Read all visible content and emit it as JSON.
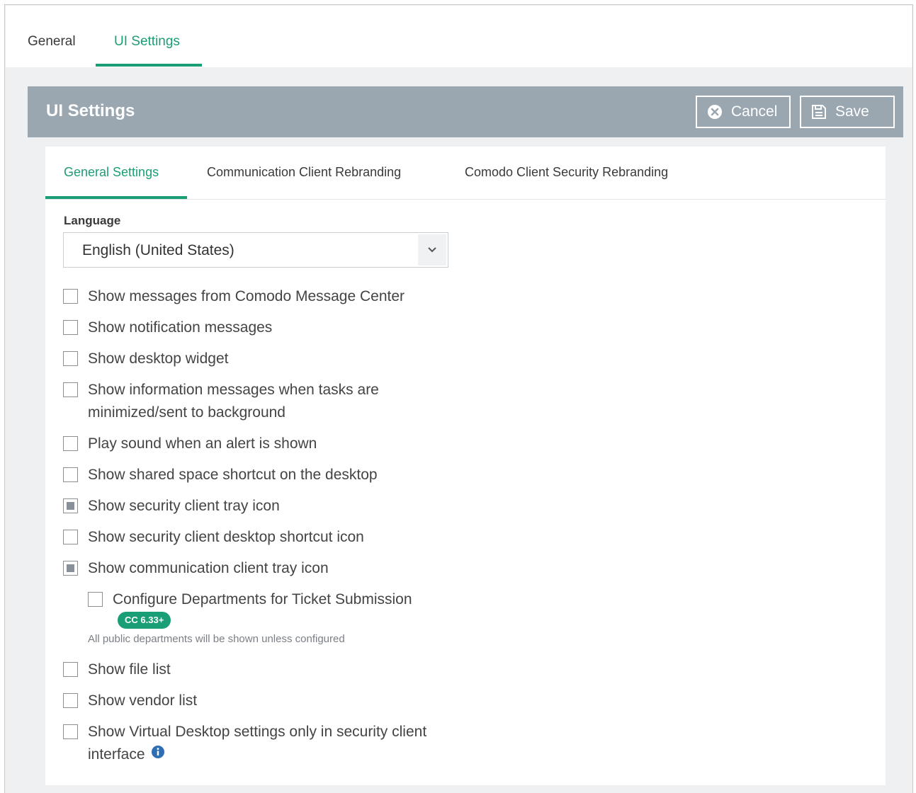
{
  "top_tabs": [
    {
      "label": "General",
      "active": false
    },
    {
      "label": "UI Settings",
      "active": true
    }
  ],
  "panel": {
    "title": "UI Settings",
    "cancel_label": "Cancel",
    "save_label": "Save"
  },
  "sub_tabs": [
    {
      "label": "General Settings",
      "active": true
    },
    {
      "label": "Communication Client Rebranding",
      "active": false
    },
    {
      "label": "Comodo Client Security Rebranding",
      "active": false
    }
  ],
  "language": {
    "label": "Language",
    "value": "English (United States)"
  },
  "options": [
    {
      "label": "Show messages from Comodo Message Center",
      "checked": false
    },
    {
      "label": "Show notification messages",
      "checked": false
    },
    {
      "label": "Show desktop widget",
      "checked": false
    },
    {
      "label": "Show information messages when tasks are minimized/sent to background",
      "checked": false
    },
    {
      "label": "Play sound when an alert is shown",
      "checked": false
    },
    {
      "label": "Show shared space shortcut on the desktop",
      "checked": false
    },
    {
      "label": "Show security client tray icon",
      "checked": true
    },
    {
      "label": "Show security client desktop shortcut icon",
      "checked": false
    },
    {
      "label": "Show communication client tray icon",
      "checked": true
    },
    {
      "label": "Configure Departments for Ticket Submission",
      "checked": false
    },
    {
      "label": "Show file list",
      "checked": false
    },
    {
      "label": "Show vendor list",
      "checked": false
    },
    {
      "label": "Show Virtual Desktop settings only in security client interface",
      "checked": false
    }
  ],
  "departments": {
    "badge": "CC 6.33+",
    "hint": "All public departments will be shown unless configured"
  },
  "colors": {
    "accent": "#1a9e75",
    "header_bg": "#9aa7b1",
    "info_icon": "#2f6db5"
  },
  "icons": {
    "cancel": "x-circle-icon",
    "save": "floppy-disk-icon",
    "select": "chevron-down-icon",
    "info": "info-icon"
  }
}
